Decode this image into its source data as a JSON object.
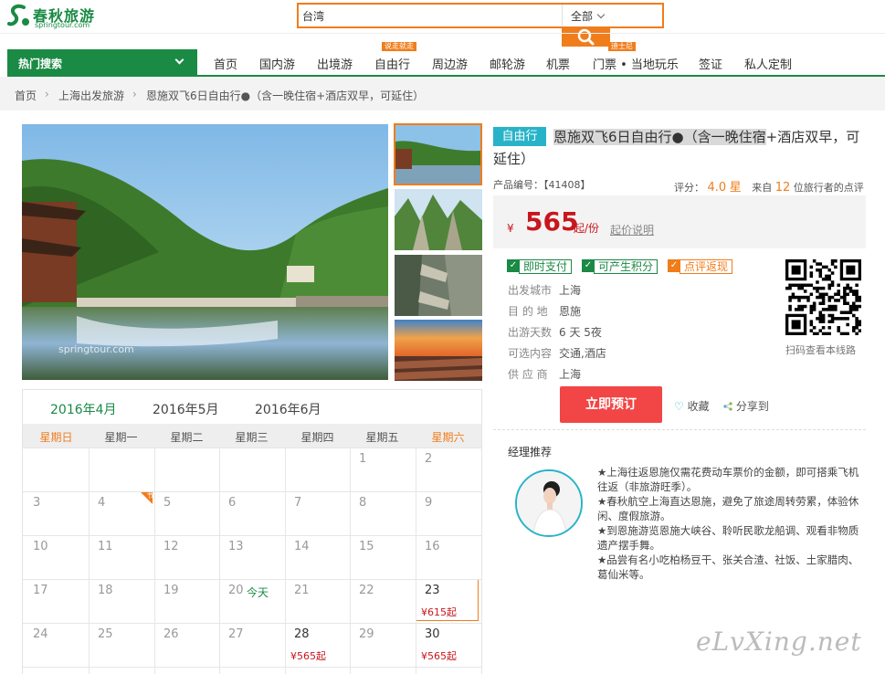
{
  "header": {
    "logo_cn": "春秋旅游",
    "logo_en": "springtour.com",
    "search_value": "台湾",
    "search_scope": "全部"
  },
  "hot_search": {
    "label": "热门搜索"
  },
  "nav": {
    "items": [
      {
        "label": "首页"
      },
      {
        "label": "国内游"
      },
      {
        "label": "出境游"
      },
      {
        "label": "自由行",
        "badge": "说走就走"
      },
      {
        "label": "周边游"
      },
      {
        "label": "邮轮游"
      },
      {
        "label": "机票"
      },
      {
        "label": "门票 • 当地玩乐",
        "badge": "迪士尼"
      },
      {
        "label": "签证"
      },
      {
        "label": "私人定制"
      }
    ]
  },
  "breadcrumb": [
    "首页",
    "上海出发旅游",
    "恩施双飞6日自由行●（含一晚住宿+酒店双早，可延住）"
  ],
  "product": {
    "tag": "自由行",
    "title_highlight": "恩施双飞6日自由行●（含一晚住宿",
    "title_rest": "+酒店双早，可延住）",
    "code_label": "产品编号：",
    "code": "【41408】",
    "rating_label": "评分：",
    "rating": "4.0",
    "rating_unit": "星",
    "from_label": "来自",
    "review_count": "12",
    "review_suffix": "位旅行者的点评",
    "currency": "¥",
    "price": "565",
    "price_unit": "起/份",
    "price_note": "起价说明",
    "features": [
      {
        "label": "即时支付",
        "color": "#1a8a44"
      },
      {
        "label": "可产生积分",
        "color": "#1a8a44"
      },
      {
        "label": "点评返现",
        "color": "#f07d1c"
      }
    ],
    "info": [
      {
        "label": "出发城市",
        "value": "上海"
      },
      {
        "label": "目 的 地",
        "value": "恩施"
      },
      {
        "label": "出游天数",
        "value": "6 天 5夜"
      },
      {
        "label": "可选内容",
        "value": "交通,酒店"
      },
      {
        "label": "供 应 商",
        "value": "上海"
      }
    ],
    "qr_caption": "扫码查看本线路",
    "book_label": "立即预订",
    "fav_label": "收藏",
    "share_label": "分享到"
  },
  "manager": {
    "title": "经理推荐",
    "lines": [
      "★上海往返恩施仅需花费动车票价的金额，即可搭乘飞机往返（非旅游旺季）。",
      "★春秋航空上海直达恩施，避免了旅途周转劳累，体验休闲、度假旅游。",
      "★到恩施游览恩施大峡谷、聆听民歌龙船调、观看非物质遗产摆手舞。",
      "★品尝有名小吃柏杨豆干、张关合渣、社饭、土家腊肉、葛仙米等。"
    ]
  },
  "calendar": {
    "months": [
      "2016年4月",
      "2016年5月",
      "2016年6月"
    ],
    "weekdays": [
      "星期日",
      "星期一",
      "星期二",
      "星期三",
      "星期四",
      "星期五",
      "星期六"
    ],
    "rows": [
      [
        "",
        "",
        "",
        "",
        "",
        "1",
        "2"
      ],
      [
        "3",
        "4",
        "5",
        "6",
        "7",
        "8",
        "9"
      ],
      [
        "10",
        "11",
        "12",
        "13",
        "14",
        "15",
        "16"
      ],
      [
        "17",
        "18",
        "19",
        "20",
        "21",
        "22",
        "23"
      ],
      [
        "24",
        "25",
        "26",
        "27",
        "28",
        "29",
        "30"
      ]
    ],
    "today_label": "今天",
    "corner_mark": "节",
    "prices": {
      "23": "¥615起",
      "28": "¥565起",
      "30": "¥565起"
    }
  },
  "photo": {
    "watermark": "springtour.com"
  },
  "watermark": "eLvXing.net",
  "colors": {
    "brand_green": "#1a8a44",
    "accent_orange": "#f07d1c",
    "price_red": "#c8161d",
    "tag_teal": "#29b3c9",
    "book_red": "#f24545"
  }
}
